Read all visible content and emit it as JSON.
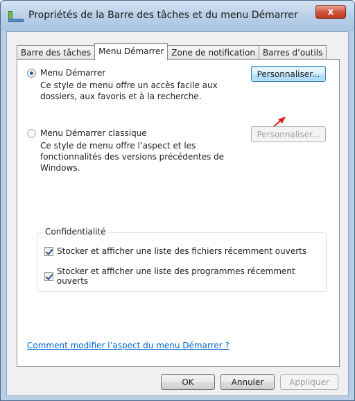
{
  "window": {
    "title": "Propriétés de la Barre des tâches et du menu Démarrer",
    "close_symbol": "x"
  },
  "tabs": [
    {
      "label": "Barre des tâches",
      "active": false
    },
    {
      "label": "Menu Démarrer",
      "active": true
    },
    {
      "label": "Zone de notification",
      "active": false
    },
    {
      "label": "Barres d’outils",
      "active": false
    }
  ],
  "start_menu": {
    "option_label": "Menu Démarrer",
    "selected": true,
    "description_line1": "Ce style de menu offre un accès facile aux",
    "description_line2": "dossiers, aux favoris et à la recherche.",
    "customize_label": "Personnaliser..."
  },
  "classic_menu": {
    "option_label": "Menu Démarrer classique",
    "selected": false,
    "description_line1": "Ce style de menu offre l’aspect et les",
    "description_line2": "fonctionnalités des versions précédentes de",
    "description_line3": "Windows.",
    "customize_label": "Personnaliser..."
  },
  "privacy": {
    "group_label": "Confidentialité",
    "store_recent_files": {
      "label": "Stocker et afficher une liste des fichiers récemment ouverts",
      "checked": true
    },
    "store_recent_programs": {
      "label": "Stocker et afficher une liste des programmes récemment ouverts",
      "checked": true
    }
  },
  "help_link": "Comment modifier l’aspect du menu Démarrer ?",
  "buttons": {
    "ok": "OK",
    "cancel": "Annuler",
    "apply": "Appliquer"
  },
  "colors": {
    "annotation_arrow": "#e0201a",
    "link": "#0066cc",
    "titlebar": "#bcd1e8"
  },
  "icons": {
    "title_icon": "taskbar-properties-icon",
    "annotation": "red-arrow-annotation"
  }
}
